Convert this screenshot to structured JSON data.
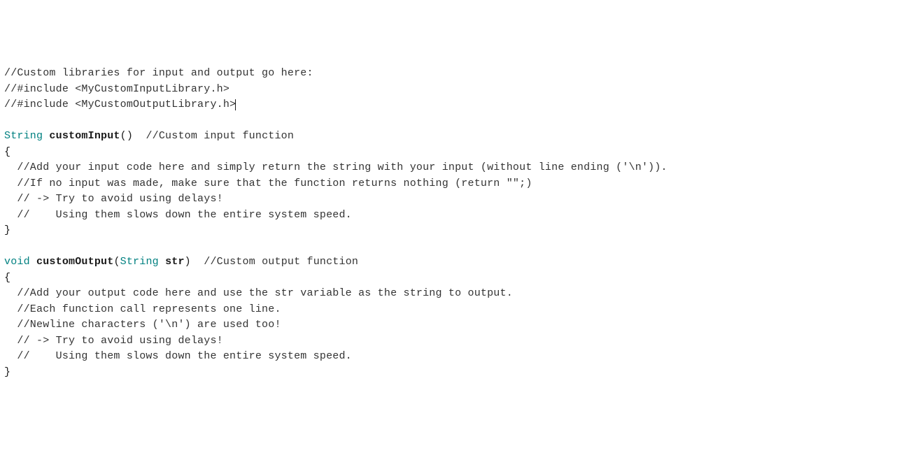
{
  "code": {
    "lines": [
      {
        "type": "comment",
        "text": "//Custom libraries for input and output go here:"
      },
      {
        "type": "comment",
        "text": "//#include <MyCustomInputLibrary.h>"
      },
      {
        "type": "comment-cursor",
        "text": "//#include <MyCustomOutputLibrary.h>"
      },
      {
        "type": "blank",
        "text": ""
      },
      {
        "type": "sig1",
        "returnType": "String",
        "funcName": "customInput",
        "params": "()",
        "trailing": "  ",
        "comment": "//Custom input function"
      },
      {
        "type": "brace",
        "text": "{"
      },
      {
        "type": "comment-indent",
        "text": "  //Add your input code here and simply return the string with your input (without line ending ('\\n'))."
      },
      {
        "type": "comment-indent",
        "text": "  //If no input was made, make sure that the function returns nothing (return \"\";)"
      },
      {
        "type": "comment-indent",
        "text": "  // -> Try to avoid using delays!"
      },
      {
        "type": "comment-indent",
        "text": "  //    Using them slows down the entire system speed."
      },
      {
        "type": "brace",
        "text": "}"
      },
      {
        "type": "blank",
        "text": ""
      },
      {
        "type": "sig2",
        "returnType": "void",
        "funcName": "customOutput",
        "paramType": "String",
        "paramName": "str",
        "trailing": "  ",
        "comment": "//Custom output function"
      },
      {
        "type": "brace",
        "text": "{"
      },
      {
        "type": "comment-indent",
        "text": "  //Add your output code here and use the str variable as the string to output."
      },
      {
        "type": "comment-indent",
        "text": "  //Each function call represents one line."
      },
      {
        "type": "comment-indent",
        "text": "  //Newline characters ('\\n') are used too!"
      },
      {
        "type": "comment-indent",
        "text": "  // -> Try to avoid using delays!"
      },
      {
        "type": "comment-indent",
        "text": "  //    Using them slows down the entire system speed."
      },
      {
        "type": "brace",
        "text": "}"
      }
    ]
  }
}
